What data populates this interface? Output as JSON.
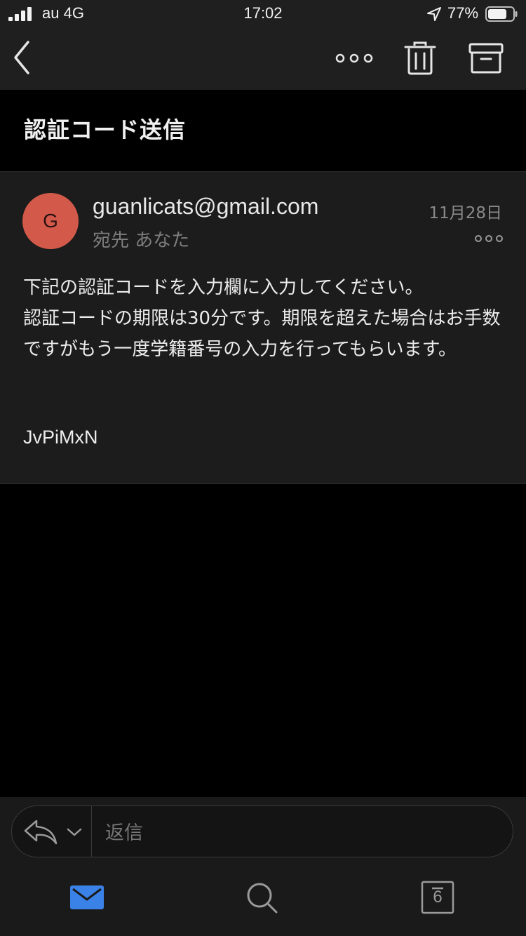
{
  "status_bar": {
    "carrier": "au 4G",
    "time": "17:02",
    "battery": "77%"
  },
  "toolbar": {
    "back_icon": "chevron-left-icon",
    "more_icon": "more-horizontal-icon",
    "delete_icon": "trash-icon",
    "archive_icon": "archive-icon"
  },
  "subject": "認証コード送信",
  "message": {
    "avatar_initial": "G",
    "sender": "guanlicats@gmail.com",
    "date": "11月28日",
    "recipient": "宛先 あなた",
    "body": "下記の認証コードを入力欄に入力してください。\n認証コードの期限は30分です。期限を超えた場合はお手数ですがもう一度学籍番号の入力を行ってもらいます。",
    "code": "JvPiMxN"
  },
  "reply": {
    "placeholder": "返信"
  },
  "tabbar": {
    "calendar_day": "6"
  },
  "colors": {
    "avatar": "#d35a4a",
    "mail_tab_active": "#3b82e8"
  }
}
